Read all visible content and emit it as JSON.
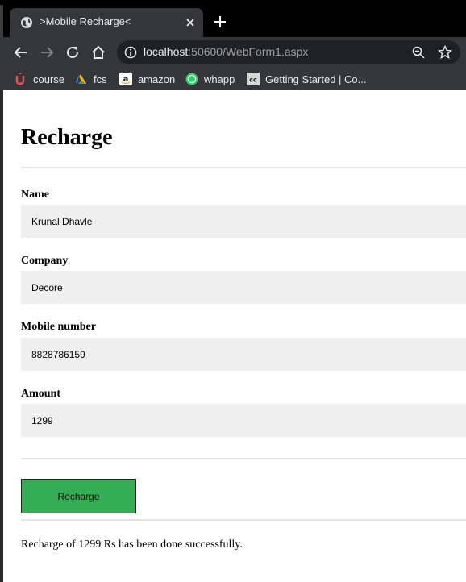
{
  "browser": {
    "tab_title": ">Mobile Recharge<",
    "url_host": "localhost",
    "url_rest": ":50600/WebForm1.aspx",
    "bookmarks": [
      {
        "label": "course",
        "icon": "udemy-icon"
      },
      {
        "label": "fcs",
        "icon": "drive-icon"
      },
      {
        "label": "amazon",
        "icon": "amazon-icon"
      },
      {
        "label": "whapp",
        "icon": "whatsapp-icon"
      },
      {
        "label": "Getting Started | Co...",
        "icon": "coursera-icon"
      }
    ]
  },
  "page": {
    "heading": "Recharge",
    "fields": [
      {
        "label": "Name",
        "value": "Krunal Dhavle"
      },
      {
        "label": "Company",
        "value": "Decore"
      },
      {
        "label": "Mobile number",
        "value": "8828786159"
      },
      {
        "label": "Amount",
        "value": "1299"
      }
    ],
    "button_label": "Recharge",
    "message": "Recharge of 1299 Rs has been done successfully."
  },
  "colors": {
    "button": "#34ad55",
    "field_bg": "#efefef",
    "toolbar": "#35363a"
  }
}
